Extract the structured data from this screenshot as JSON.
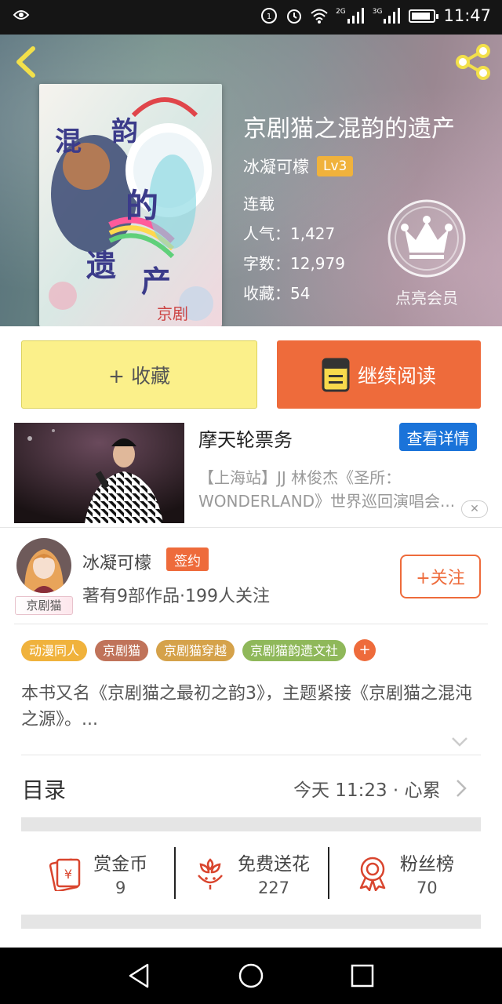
{
  "status_bar": {
    "time": "11:47",
    "network_1": "2G",
    "network_2": "3G",
    "battery_level": 0.85
  },
  "header": {
    "book_title": "京剧猫之混韵的遗产",
    "author_name": "冰凝可檬",
    "level_badge": "Lv3",
    "status": "连载",
    "popularity": "人气：1,427",
    "word_count": "字数：12,979",
    "favorites": "收藏：54",
    "member_label": "点亮会员"
  },
  "actions": {
    "collect_label": "+ 收藏",
    "read_label": "继续阅读"
  },
  "ad": {
    "title": "摩天轮票务",
    "detail_button": "查看详情",
    "description": "【上海站】JJ 林俊杰《圣所：WONDERLAND》世界巡回演唱会..."
  },
  "author": {
    "name": "冰凝可檬",
    "sign_badge": "签约",
    "avatar_tag": "京剧猫",
    "info": "著有9部作品·199人关注",
    "follow_label": "+关注"
  },
  "tags": [
    {
      "label": "动漫同人",
      "color": "#f0b23c"
    },
    {
      "label": "京剧猫",
      "color": "#c0735a"
    },
    {
      "label": "京剧猫穿越",
      "color": "#d5a24a"
    },
    {
      "label": "京剧猫韵遗文社",
      "color": "#8fb85a"
    }
  ],
  "tag_more": "+",
  "description": "本书又名《京剧猫之最初之韵3》，主题紧接《京剧猫之混沌之源》。...",
  "toc": {
    "label": "目录",
    "update_info": "今天 11:23 · 心累"
  },
  "stats": [
    {
      "label": "赏金币",
      "value": "9",
      "icon": "red-envelope-icon"
    },
    {
      "label": "免费送花",
      "value": "227",
      "icon": "flower-icon"
    },
    {
      "label": "粉丝榜",
      "value": "70",
      "icon": "medal-icon"
    }
  ],
  "colors": {
    "accent": "#ee6b3b",
    "collect_bg": "#fbf08a",
    "ad_button": "#1a73d9"
  }
}
